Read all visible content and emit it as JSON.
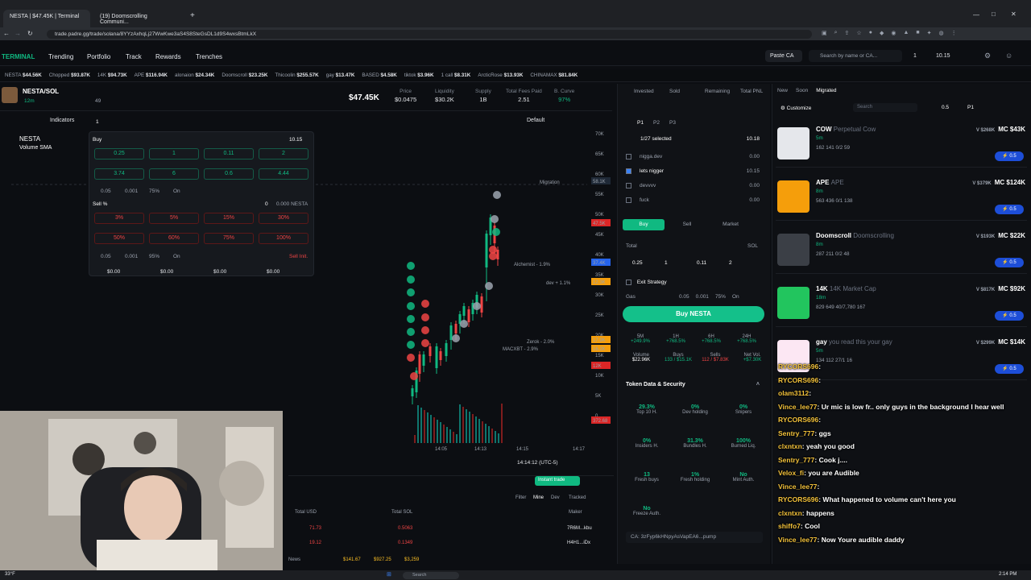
{
  "browser": {
    "tabs": [
      "NESTA | $47.45K | Terminal",
      "(19) Doomscrolling Communi..."
    ],
    "url": "trade.padre.gg/trade/solana/8YYzAxhqLj27WwKwe3aS4S8SteGsDL1d9S4wxsBtmLkX"
  },
  "nav": {
    "logo": "TERMINAL",
    "items": [
      "Trending",
      "Portfolio",
      "Track",
      "Rewards",
      "Trenches"
    ],
    "paste": "Paste CA",
    "search_placeholder": "Search by name or CA...",
    "wallet_count": "1",
    "balance": "10.15"
  },
  "ticker": [
    {
      "name": "NESTA",
      "value": "$44.56K"
    },
    {
      "name": "Chopped",
      "value": "$93.87K"
    },
    {
      "name": "14K",
      "value": "$94.73K"
    },
    {
      "name": "APE",
      "value": "$116.94K"
    },
    {
      "name": "alonaion",
      "value": "$24.34K"
    },
    {
      "name": "Doomscroll",
      "value": "$23.25K"
    },
    {
      "name": "Thicoolin",
      "value": "$255.57K"
    },
    {
      "name": "gay",
      "value": "$13.47K"
    },
    {
      "name": "BASED",
      "value": "$4.58K"
    },
    {
      "name": "tiktok",
      "value": "$3.96K"
    },
    {
      "name": "1 call",
      "value": "$8.31K"
    },
    {
      "name": "ArcticRose",
      "value": "$13.93K"
    },
    {
      "name": "CHINAMAX",
      "value": "$81.84K"
    }
  ],
  "token": {
    "pair": "NESTA/SOL",
    "age": "12m",
    "holders": "49",
    "mcap": "$47.45K",
    "stats": [
      {
        "label": "Price",
        "value": "$0.0475"
      },
      {
        "label": "Liquidity",
        "value": "$30.2K"
      },
      {
        "label": "Supply",
        "value": "1B"
      },
      {
        "label": "Total Fees Paid",
        "value": "2.51"
      },
      {
        "label": "B. Curve",
        "value": "97%"
      }
    ],
    "chart_title": "NESTA",
    "indicator": "Volume SMA",
    "indicators_btn": "Indicators",
    "default_btn": "Default"
  },
  "chart_data": {
    "type": "line",
    "yaxis_ticks": [
      "70K",
      "65K",
      "60K",
      "55K",
      "50K",
      "45K",
      "40K",
      "35K",
      "30K",
      "25K",
      "20K",
      "15K",
      "10K",
      "5K",
      "0"
    ],
    "xaxis_ticks": [
      "14:05",
      "14:13",
      "14:15",
      "14:17"
    ],
    "price_labels": [
      "58.1K",
      "47.5K",
      "37.4K",
      "12.3K",
      "17.9K",
      "16.2K",
      "12K",
      "372.68"
    ],
    "annotations": [
      "Migration",
      "Alchemist - 1.9%",
      "dev + 1.1%",
      "Zerok - 2.0%",
      "MACXBT - 2.9%"
    ],
    "clock": "14:14:12 (UTC-5)",
    "scale": [
      "%",
      "log",
      "auto"
    ]
  },
  "quick": {
    "wallet_count": "1",
    "balance": "10.15",
    "buy_label": "Buy",
    "buy_row1": [
      "0.25",
      "1",
      "0.11",
      "2"
    ],
    "buy_row2": [
      "3.74",
      "6",
      "0.6",
      "4.44"
    ],
    "buy_settings": [
      "0.05",
      "0.001",
      "75%",
      "On"
    ],
    "sell_label": "Sell %",
    "sell_balance": "0",
    "sell_token": "0.000 NESTA",
    "sell_row1": [
      "3%",
      "5%",
      "15%",
      "30%"
    ],
    "sell_row2": [
      "50%",
      "60%",
      "75%",
      "100%"
    ],
    "sell_settings": [
      "0.05",
      "0.001",
      "95%",
      "On"
    ],
    "sell_init": "Sell Init.",
    "totals": [
      "$0.00",
      "$0.00",
      "$0.00",
      "$0.00"
    ]
  },
  "trade": {
    "headers": [
      "Invested",
      "Sold",
      "Remaining",
      "Total PNL"
    ],
    "presets": [
      "P1",
      "P2",
      "P3"
    ],
    "selected": "1/27 selected",
    "selected_bal": "10.18",
    "wallets": [
      {
        "name": "nigga.dev",
        "bal": "0.00"
      },
      {
        "name": "lets nigger",
        "bal": "10.15"
      },
      {
        "name": "devvvv",
        "bal": "0.00"
      },
      {
        "name": "fuck",
        "bal": "0.00"
      }
    ],
    "tabs": [
      "Buy",
      "Sell",
      "Market"
    ],
    "total_label": "Total",
    "total_unit": "SOL",
    "amounts": [
      "0.25",
      "1",
      "0.11",
      "2"
    ],
    "exit": "Exit Strategy",
    "gas": "Gas",
    "gas_vals": [
      "0.05",
      "0.001",
      "75%",
      "On"
    ],
    "buy_btn": "Buy NESTA",
    "periods": [
      {
        "t": "5M",
        "v": "+249.9%"
      },
      {
        "t": "1H",
        "v": "+768.5%"
      },
      {
        "t": "6H",
        "v": "+768.5%"
      },
      {
        "t": "24H",
        "v": "+768.5%"
      }
    ],
    "vol": [
      {
        "l": "Volume",
        "v": "$22.96K"
      },
      {
        "l": "Buys",
        "v": "133 / $15.1K"
      },
      {
        "l": "Sells",
        "v": "112 / $7.83K"
      },
      {
        "l": "Net Vol.",
        "v": "+$7.30K"
      }
    ],
    "security_title": "Token Data & Security",
    "sec": [
      {
        "v": "29.3%",
        "l": "Top 10 H."
      },
      {
        "v": "0%",
        "l": "Dev holding"
      },
      {
        "v": "0%",
        "l": "Snipers"
      },
      {
        "v": "0%",
        "l": "Insiders H."
      },
      {
        "v": "31.3%",
        "l": "Bundles H."
      },
      {
        "v": "100%",
        "l": "Burned Liq."
      },
      {
        "v": "13",
        "l": "Fresh buys"
      },
      {
        "v": "1%",
        "l": "Fresh holding"
      },
      {
        "v": "No",
        "l": "Mint Auth."
      },
      {
        "v": "No",
        "l": "Freeze Auth."
      }
    ],
    "ca": "CA: 3zFyp6kHNpyAsVapEA6...pump"
  },
  "list": {
    "tabs": [
      "New",
      "Soon",
      "Migrated"
    ],
    "customize": "Customize",
    "search": "Search",
    "p1": "P1",
    "amount": "0.5",
    "tokens": [
      {
        "name": "COW",
        "sub": "Perpetual Cow",
        "age": "5m",
        "mc": "$268K",
        "mc2": "$43K",
        "h": "162 141 0/2 59",
        "color": "#e5e7eb"
      },
      {
        "name": "APE",
        "sub": "APE",
        "age": "8m",
        "mc": "$379K",
        "mc2": "$124K",
        "h": "563 436 0/1 138",
        "color": "#f59e0b"
      },
      {
        "name": "Doomscroll",
        "sub": "Doomscrolling",
        "age": "8m",
        "mc": "$193K",
        "mc2": "$22K",
        "h": "287 211 0/2 48",
        "color": "#3b3f46"
      },
      {
        "name": "14K",
        "sub": "14K Market Cap",
        "age": "18m",
        "mc": "$817K",
        "mc2": "$92K",
        "h": "829 649 40/7,780 167",
        "color": "#22c55e"
      },
      {
        "name": "gay",
        "sub": "you read this your gay",
        "age": "5m",
        "mc": "$299K",
        "mc2": "$14K",
        "h": "134 112 27/1 16",
        "color": "#fce7f3"
      }
    ],
    "pill": "0.5"
  },
  "chat": [
    {
      "u": "RYCORS696",
      "m": ": "
    },
    {
      "u": "RYCORS696",
      "m": ": "
    },
    {
      "u": "olam3112",
      "m": ": "
    },
    {
      "u": "Vince_lee77",
      "m": ": Ur mic is low fr.. only guys in the background I hear well"
    },
    {
      "u": "RYCORS696",
      "m": ": "
    },
    {
      "u": "Sentry_777",
      "m": ": ggs"
    },
    {
      "u": "clxntxn",
      "m": ": yeah you good"
    },
    {
      "u": "Sentry_777",
      "m": ": Cook j...."
    },
    {
      "u": "Velox_fi",
      "m": ": you are Audible"
    },
    {
      "u": "Vince_lee77",
      "m": ": "
    },
    {
      "u": "RYCORS696",
      "m": ": What happened to volume can't here you"
    },
    {
      "u": "clxntxn",
      "m": ": happens"
    },
    {
      "u": "shiffo7",
      "m": ": Cool"
    },
    {
      "u": "Vince_lee77",
      "m": ": Now Youre audible daddy"
    }
  ],
  "bottom": {
    "buttons": [
      "Instant trade"
    ],
    "filters": [
      "Filter",
      "Mine",
      "Dev",
      "Tracked"
    ],
    "cols": [
      "Total USD",
      "Total SOL",
      "Maker"
    ],
    "rows": [
      {
        "usd": "71.73",
        "sol": "0.5063",
        "maker": "7R6M...kbu"
      },
      {
        "usd": "19.12",
        "sol": "0.1349",
        "maker": "H4H1...iDx"
      }
    ],
    "status": [
      "News",
      "$141.67",
      "$927.25",
      "$3,259"
    ]
  },
  "taskbar": {
    "time": "2:14 PM",
    "temp": "33°F",
    "search": "Search"
  }
}
